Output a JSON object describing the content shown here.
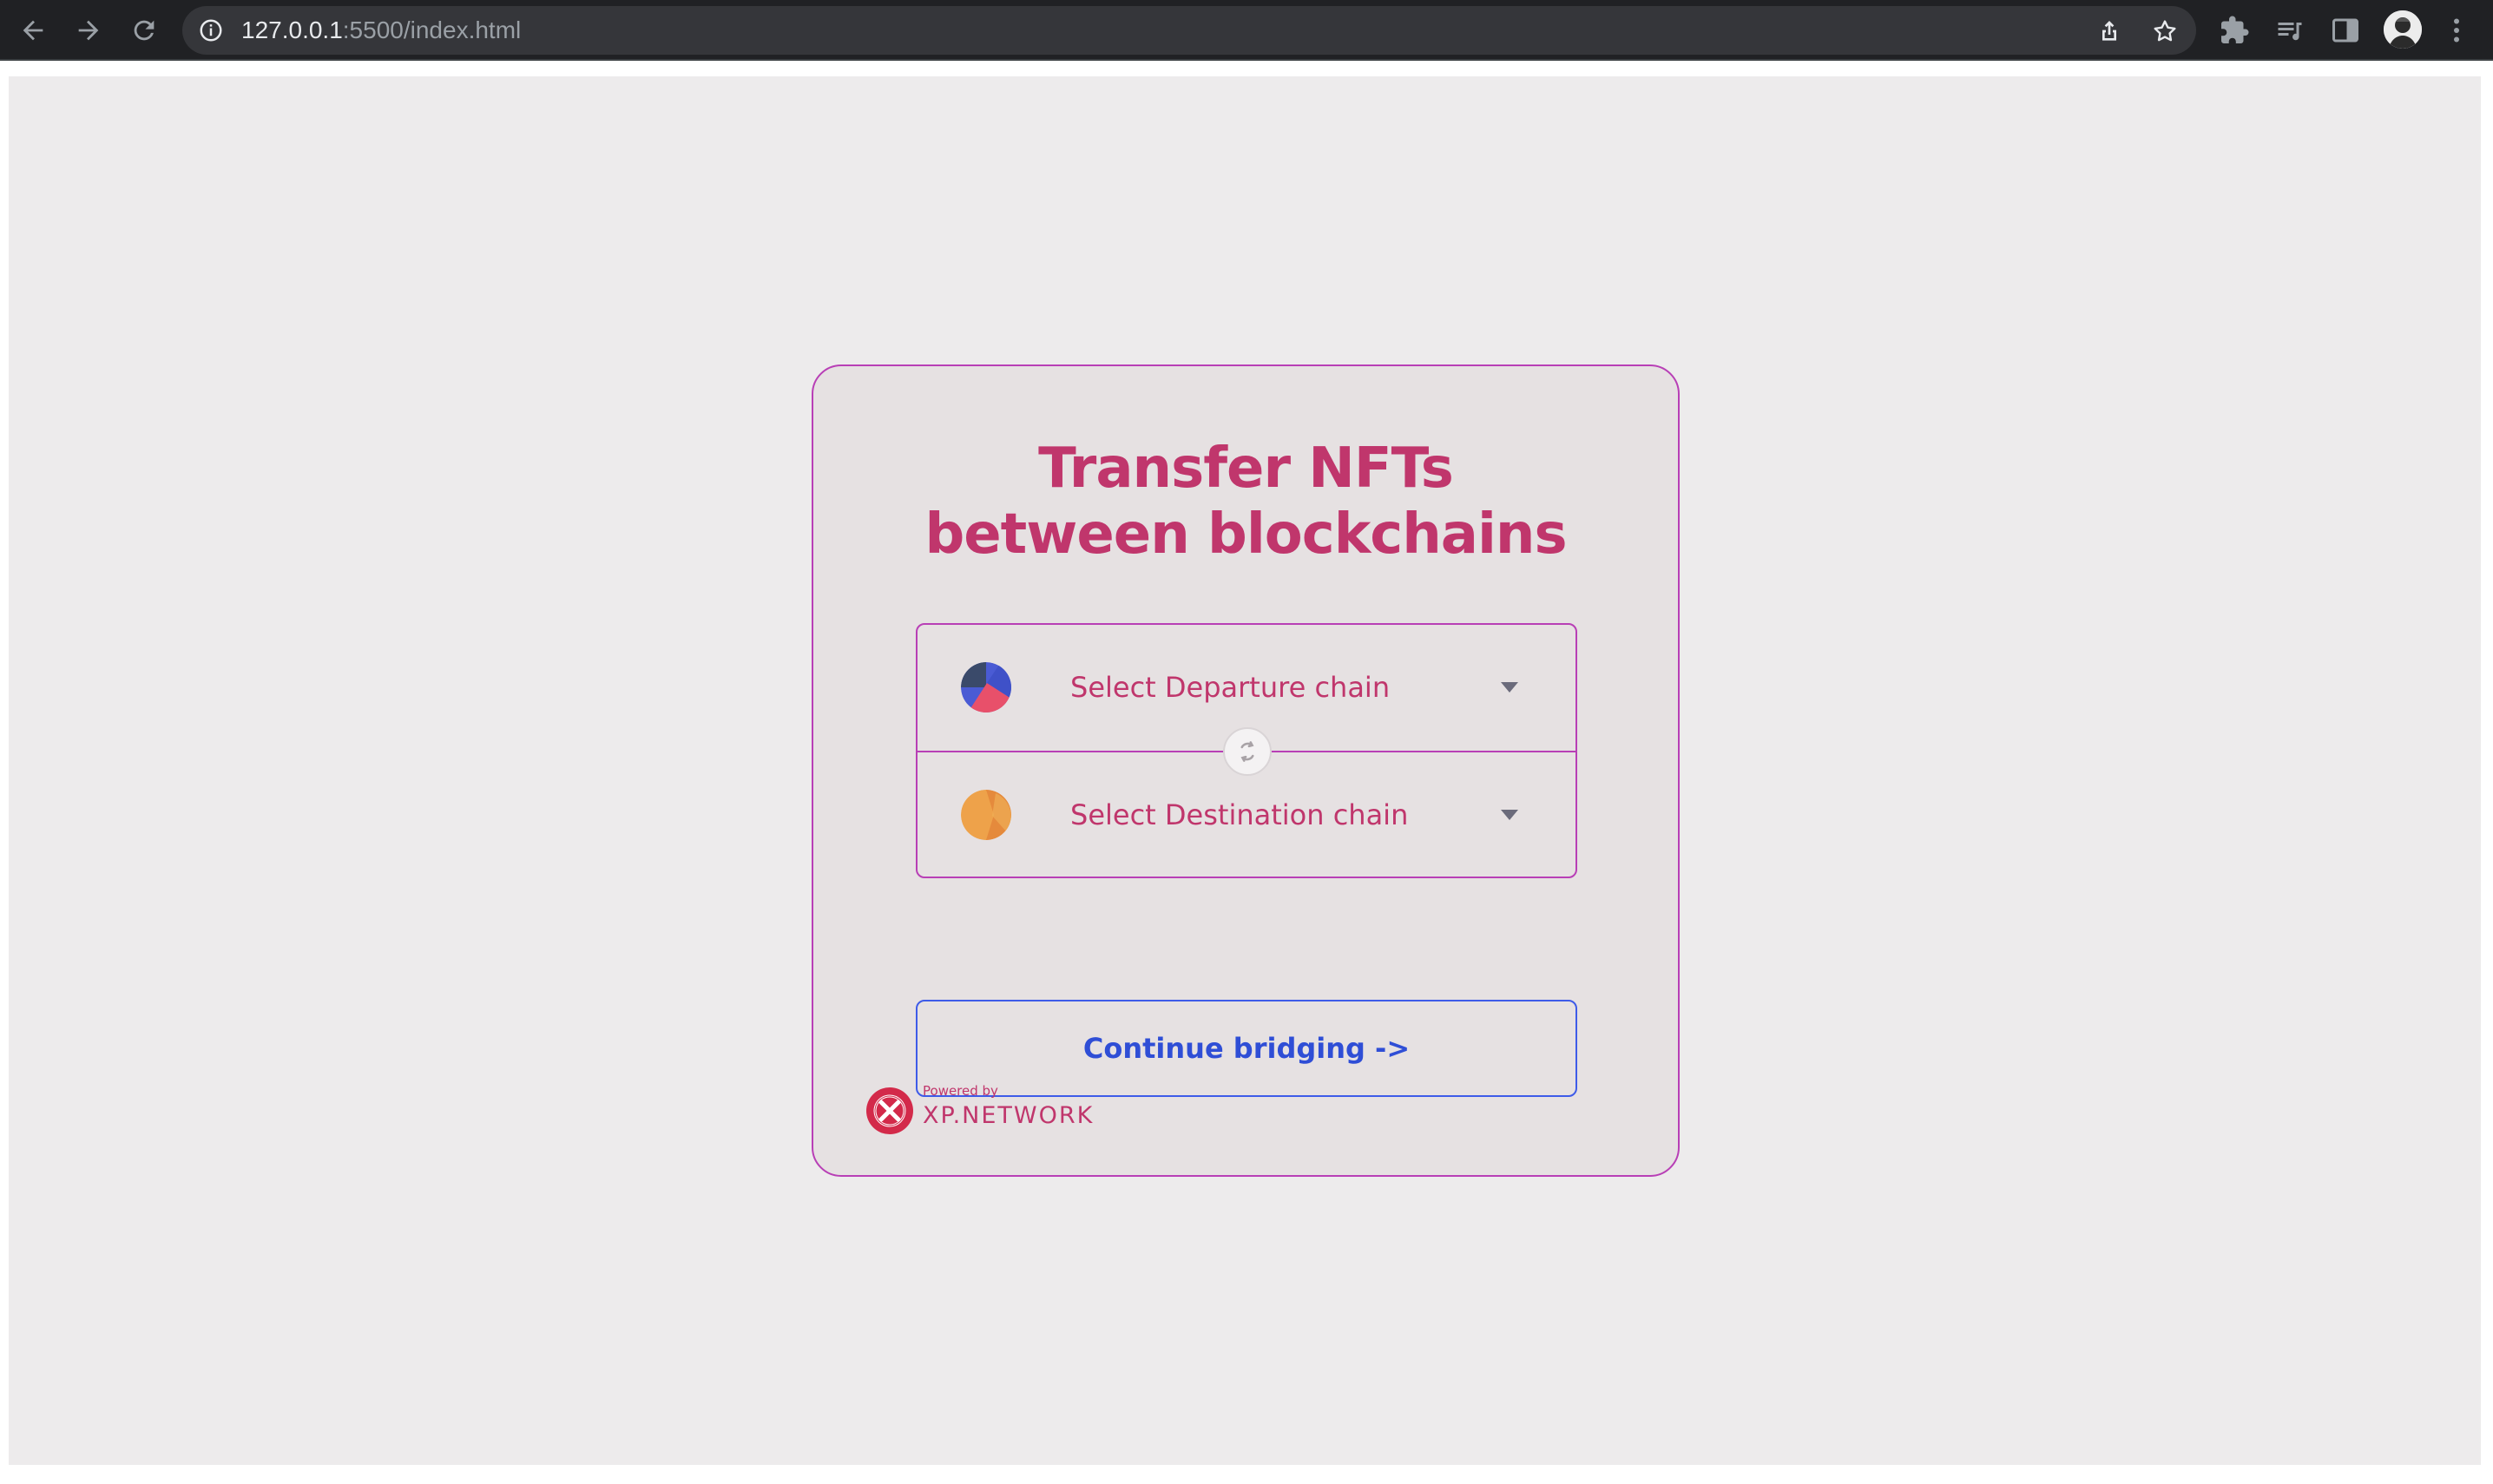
{
  "browser": {
    "url_host": "127.0.0.1",
    "url_path": ":5500/index.html",
    "icons": {
      "back": "arrow-left-icon",
      "forward": "arrow-right-icon",
      "reload": "reload-icon",
      "site_info": "info-icon",
      "share": "share-icon",
      "bookmark": "star-icon",
      "extensions": "puzzle-icon",
      "media": "media-queue-icon",
      "side_panel": "side-panel-icon",
      "profile": "avatar",
      "menu": "kebab-menu-icon"
    }
  },
  "card": {
    "title_line1": "Transfer NFTs",
    "title_line2": "between blockchains",
    "departure": {
      "label": "Select Departure chain",
      "icon": "departure-chain-icon"
    },
    "destination": {
      "label": "Select Destination chain",
      "icon": "destination-chain-icon"
    },
    "swap_icon": "swap-icon",
    "continue_label": "Continue bridging ->",
    "footer": {
      "powered_by": "Powered by",
      "brand": "XP.NETWORK"
    }
  },
  "colors": {
    "accent": "#c0366c",
    "border": "#b83fb6",
    "button": "#2f4ed6",
    "card_bg": "#e6e1e2",
    "page_bg": "#edebec"
  }
}
